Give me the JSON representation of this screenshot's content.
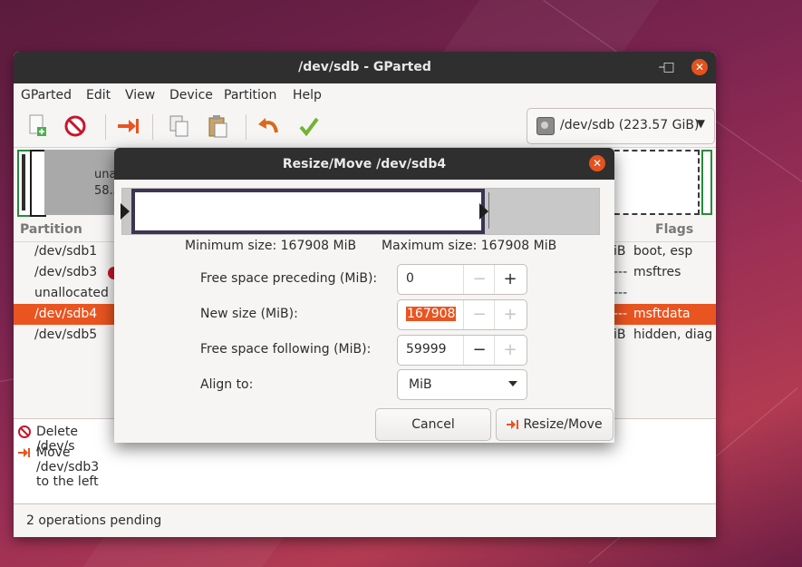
{
  "window": {
    "title": "/dev/sdb - GParted",
    "minimize_glyph": "–",
    "maximize_glyph": "□",
    "close_glyph": "✕"
  },
  "menu": [
    "GParted",
    "Edit",
    "View",
    "Device",
    "Partition",
    "Help"
  ],
  "toolbar": {
    "icons": [
      "new-partition-icon",
      "delete-icon",
      "resize-move-icon",
      "copy-icon",
      "paste-icon",
      "undo-icon",
      "apply-icon"
    ],
    "device_label": "/dev/sdb (223.57 GiB)",
    "device_arrow": "▼"
  },
  "diskmap": {
    "unallocated_line1": "una",
    "unallocated_line2": "58.5"
  },
  "partitions": {
    "header_partition": "Partition",
    "header_flags": "Flags",
    "rows": [
      {
        "name": "/dev/sdb1",
        "size_tail": "iB",
        "flags": "boot, esp"
      },
      {
        "name": "/dev/sdb3",
        "size_tail": "---",
        "flags": "msftres"
      },
      {
        "name": "unallocated",
        "size_tail": "---",
        "flags": ""
      },
      {
        "name": "/dev/sdb4",
        "size_tail": "---",
        "flags": "msftdata"
      },
      {
        "name": "/dev/sdb5",
        "size_tail": "iB",
        "flags": "hidden, diag"
      }
    ]
  },
  "operations": {
    "items": [
      {
        "text": "Delete /dev/s",
        "icon": "delete-icon"
      },
      {
        "text": "Move /dev/sdb3 to the left",
        "icon": "resize-move-icon"
      }
    ],
    "status": "2 operations pending"
  },
  "dialog": {
    "title": "Resize/Move /dev/sdb4",
    "min_size": "Minimum size: 167908 MiB",
    "max_size": "Maximum size: 167908 MiB",
    "fields": {
      "preceding_label": "Free space preceding (MiB):",
      "preceding_value": "0",
      "new_size_label": "New size (MiB):",
      "new_size_value": "167908",
      "following_label": "Free space following (MiB):",
      "following_value": "59999",
      "align_label": "Align to:",
      "align_value": "MiB"
    },
    "minus_glyph": "−",
    "plus_glyph": "+",
    "cancel_label": "Cancel",
    "resize_label": "Resize/Move"
  },
  "colors": {
    "accent": "#e95420",
    "titlebar": "#2f2f2f",
    "partition_border": "#3c3452",
    "fs_green": "#2a8a3a"
  }
}
